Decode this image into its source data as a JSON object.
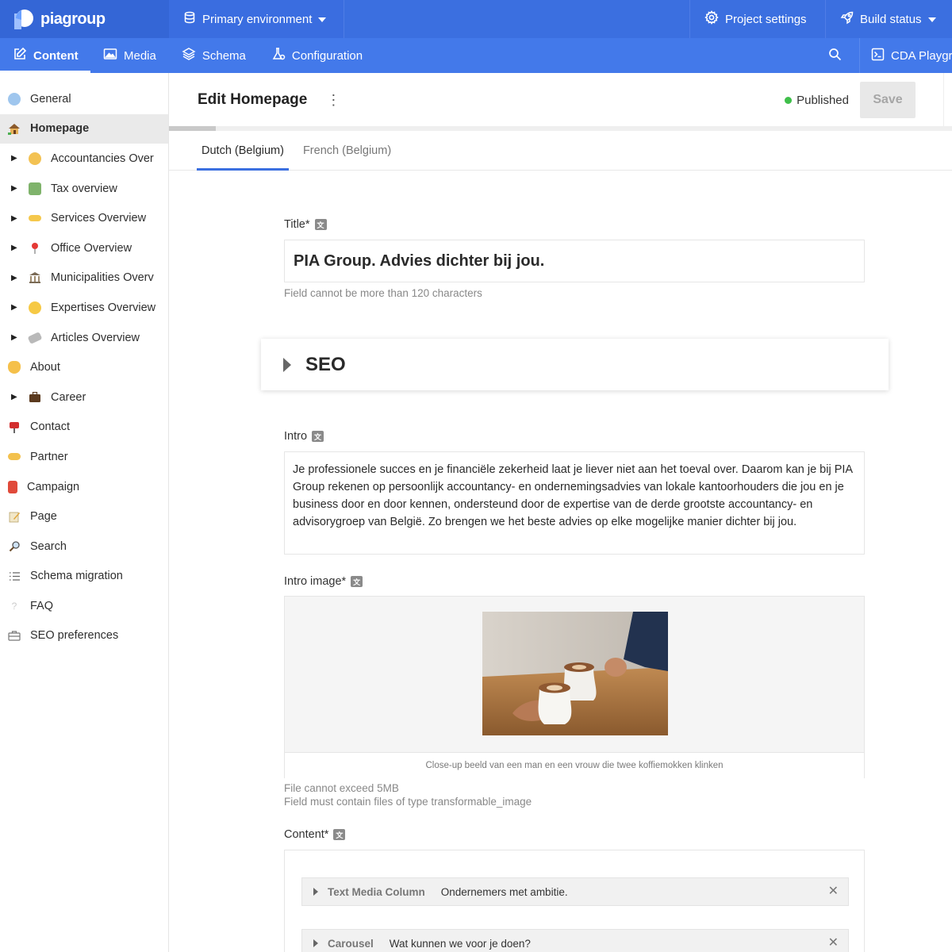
{
  "app": {
    "logo_text": "piagroup",
    "environment": "Primary environment",
    "project_settings": "Project settings",
    "build_status": "Build status",
    "accent": "#3b6fe0"
  },
  "nav": {
    "tabs": [
      {
        "label": "Content",
        "icon": "edit-icon",
        "active": true
      },
      {
        "label": "Media",
        "icon": "image-icon"
      },
      {
        "label": "Schema",
        "icon": "layers-icon"
      },
      {
        "label": "Configuration",
        "icon": "flask-icon"
      }
    ],
    "cda_playground": "CDA Playgro"
  },
  "sidebar": {
    "items": [
      {
        "label": "General",
        "icon": "globe-icon"
      },
      {
        "label": "Homepage",
        "icon": "house-icon",
        "active": true
      },
      {
        "label": "Accountancies Over",
        "icon": "accountant-icon"
      },
      {
        "label": "Tax overview",
        "icon": "money-icon"
      },
      {
        "label": "Services Overview",
        "icon": "hands-icon"
      },
      {
        "label": "Office Overview",
        "icon": "pin-icon"
      },
      {
        "label": "Municipalities Overv",
        "icon": "building-icon"
      },
      {
        "label": "Expertises Overview",
        "icon": "smile-icon"
      },
      {
        "label": "Articles Overview",
        "icon": "newspaper-icon"
      },
      {
        "label": "About",
        "icon": "wave-icon"
      },
      {
        "label": "Career",
        "icon": "briefcase-icon"
      },
      {
        "label": "Contact",
        "icon": "mailbox-icon"
      },
      {
        "label": "Partner",
        "icon": "handshake-icon"
      },
      {
        "label": "Campaign",
        "icon": "campaign-icon"
      },
      {
        "label": "Page",
        "icon": "memo-icon"
      },
      {
        "label": "Search",
        "icon": "magnifier-icon"
      },
      {
        "label": "Schema migration",
        "icon": "list-icon"
      },
      {
        "label": "FAQ",
        "icon": "question-icon"
      },
      {
        "label": "SEO preferences",
        "icon": "toolbox-icon"
      }
    ]
  },
  "editor": {
    "title": "Edit Homepage",
    "status": "Published",
    "status_color": "#3fbf4a",
    "save_label": "Save",
    "progress": 0.06,
    "locales": [
      {
        "label": "Dutch (Belgium)",
        "active": true
      },
      {
        "label": "French (Belgium)"
      }
    ],
    "fields": {
      "title_label": "Title*",
      "title_value": "PIA Group. Advies dichter bij jou.",
      "title_hint": "Field cannot be more than 120 characters",
      "seo_label": "SEO",
      "intro_label": "Intro",
      "intro_value": "Je professionele succes en je financiële zekerheid laat je liever niet aan het toeval over. Daarom kan je bij PIA Group rekenen op persoonlijk accountancy- en ondernemingsadvies van lokale kantoorhouders die jou en je business door en door kennen, ondersteund door de expertise van de derde grootste accountancy- en advisorygroep van België. Zo brengen we het beste advies op elke mogelijke manier dichter bij jou.",
      "image_label": "Intro image*",
      "image_caption": "Close-up beeld van een man en een vrouw die twee koffiemokken klinken",
      "image_hint_1": "File cannot exceed 5MB",
      "image_hint_2": "Field must contain files of type transformable_image",
      "content_label": "Content*",
      "slices": [
        {
          "type": "Text Media Column",
          "value": "Ondernemers met ambitie."
        },
        {
          "type": "Carousel",
          "value": "Wat kunnen we voor je doen?"
        }
      ]
    }
  }
}
